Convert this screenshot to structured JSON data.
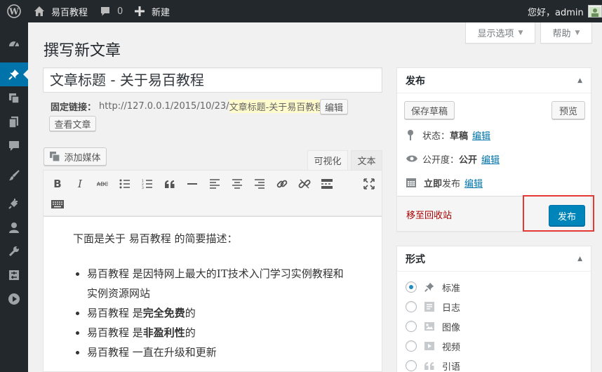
{
  "admin_bar": {
    "site_name": "易百教程",
    "comment_count": "0",
    "new_label": "新建",
    "greeting": "您好，admin"
  },
  "screen_tabs": {
    "screen_options": "显示选项",
    "help": "帮助"
  },
  "page": {
    "title": "撰写新文章"
  },
  "post": {
    "title_value": "文章标题 - 关于易百教程",
    "permalink_label": "固定链接：",
    "permalink_base": "http://127.0.0.1/2015/10/23/",
    "permalink_slug": "文章标题-关于易百教程",
    "permalink_tail": "/",
    "edit_label": "编辑",
    "view_label": "查看文章"
  },
  "editor": {
    "add_media": "添加媒体",
    "tab_visual": "可视化",
    "tab_text": "文本",
    "intro": "下面是关于 易百教程 的简要描述：",
    "items": [
      {
        "pre": "易百教程 是因特网上最大的IT技术入门学习实例教程和实例资源网站",
        "bold": "",
        "post": ""
      },
      {
        "pre": "易百教程 是",
        "bold": "完全免费",
        "post": "的"
      },
      {
        "pre": "易百教程 是",
        "bold": "非盈利性",
        "post": "的"
      },
      {
        "pre": "易百教程 一直在升级和更新",
        "bold": "",
        "post": ""
      }
    ]
  },
  "publish_box": {
    "title": "发布",
    "save_draft": "保存草稿",
    "preview": "预览",
    "status_label": "状态：",
    "status_value": "草稿",
    "visibility_label": "公开度：",
    "visibility_value": "公开",
    "publish_time_bold": "立即",
    "publish_time_rest": "发布",
    "edit": "编辑",
    "trash": "移至回收站",
    "publish_button": "发布"
  },
  "format_box": {
    "title": "形式",
    "options": [
      "标准",
      "日志",
      "图像",
      "视频",
      "引语"
    ],
    "selected": "标准"
  },
  "colors": {
    "admin_bar": "#23282d",
    "accent": "#0073aa",
    "publish_button": "#0085ba",
    "highlight": "#e53935",
    "trash": "#a00"
  }
}
